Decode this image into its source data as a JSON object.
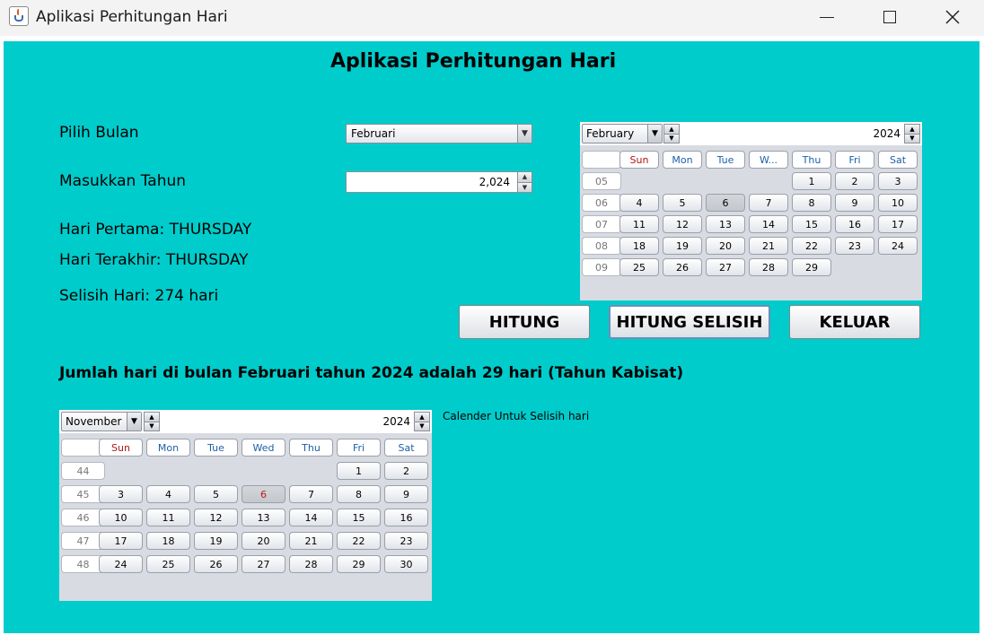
{
  "window": {
    "title": "Aplikasi Perhitungan Hari"
  },
  "form": {
    "heading": "Aplikasi Perhitungan Hari",
    "month_label": "Pilih Bulan",
    "month_value": "Februari",
    "year_label": "Masukkan Tahun",
    "year_value": "2,024",
    "first_day": "Hari Pertama: THURSDAY",
    "last_day": "Hari Terakhir: THURSDAY",
    "difference": "Selisih Hari: 274 hari",
    "summary": "Jumlah hari di bulan Februari tahun 2024 adalah 29 hari (Tahun Kabisat)",
    "caption": "Calender Untuk Selisih hari"
  },
  "buttons": {
    "hitung": "HITUNG",
    "hitung_selisih": "HITUNG SELISIH",
    "keluar": "KELUAR"
  },
  "calendar_top": {
    "month": "February",
    "year": "2024",
    "headers": [
      "Sun",
      "Mon",
      "Tue",
      "W...",
      "Thu",
      "Fri",
      "Sat"
    ],
    "weeks": [
      {
        "num": "05",
        "days": [
          "",
          "",
          "",
          "",
          "1",
          "2",
          "3"
        ]
      },
      {
        "num": "06",
        "days": [
          "4",
          "5",
          "6",
          "7",
          "8",
          "9",
          "10"
        ]
      },
      {
        "num": "07",
        "days": [
          "11",
          "12",
          "13",
          "14",
          "15",
          "16",
          "17"
        ]
      },
      {
        "num": "08",
        "days": [
          "18",
          "19",
          "20",
          "21",
          "22",
          "23",
          "24"
        ]
      },
      {
        "num": "09",
        "days": [
          "25",
          "26",
          "27",
          "28",
          "29",
          "",
          ""
        ]
      }
    ],
    "selected_day": "6"
  },
  "calendar_bottom": {
    "month": "November",
    "year": "2024",
    "headers": [
      "Sun",
      "Mon",
      "Tue",
      "Wed",
      "Thu",
      "Fri",
      "Sat"
    ],
    "weeks": [
      {
        "num": "44",
        "days": [
          "",
          "",
          "",
          "",
          "",
          "1",
          "2"
        ]
      },
      {
        "num": "45",
        "days": [
          "3",
          "4",
          "5",
          "6",
          "7",
          "8",
          "9"
        ]
      },
      {
        "num": "46",
        "days": [
          "10",
          "11",
          "12",
          "13",
          "14",
          "15",
          "16"
        ]
      },
      {
        "num": "47",
        "days": [
          "17",
          "18",
          "19",
          "20",
          "21",
          "22",
          "23"
        ]
      },
      {
        "num": "48",
        "days": [
          "24",
          "25",
          "26",
          "27",
          "28",
          "29",
          "30"
        ]
      }
    ],
    "selected_day": "6"
  },
  "colors": {
    "background": "#00cccc",
    "calendar_bg": "#d8dbe2",
    "sunday_header": "#b01515",
    "weekday_header": "#1d5fa8"
  }
}
